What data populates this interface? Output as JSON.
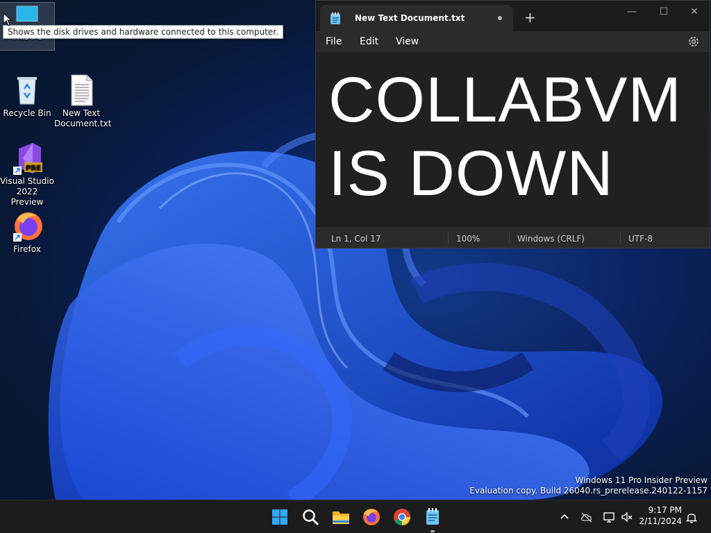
{
  "desktop": {
    "icons": [
      {
        "label": "This PC"
      },
      {
        "label": "Recycle Bin"
      },
      {
        "label": "New Text Document.txt",
        "line1": "New Text",
        "line2": "Document.txt"
      },
      {
        "label": "Visual Studio 2022 Preview",
        "line1": "Visual Studio",
        "line2": "2022 Preview",
        "badge": "PRE"
      },
      {
        "label": "Firefox"
      }
    ],
    "tooltip": "Shows the disk drives and hardware connected to this computer.",
    "watermark": {
      "line1": "Windows 11 Pro Insider Preview",
      "line2": "Evaluation copy. Build 26040.rs_prerelease.240122-1157"
    }
  },
  "notepad": {
    "tab_title": "New Text Document.txt",
    "new_tab": "+",
    "menu": [
      "File",
      "Edit",
      "View"
    ],
    "content": "COLLABVM\nIS DOWN",
    "status": {
      "position": "Ln 1, Col 17",
      "zoom": "100%",
      "line_endings": "Windows (CRLF)",
      "encoding": "UTF-8"
    },
    "window_controls": {
      "minimize": "—",
      "maximize": "☐",
      "close": "✕"
    }
  },
  "taskbar": {
    "apps": [
      {
        "name": "Start",
        "icon": "windows-logo-icon"
      },
      {
        "name": "Search",
        "icon": "search-icon"
      },
      {
        "name": "File Explorer",
        "icon": "folder-icon"
      },
      {
        "name": "Firefox",
        "icon": "firefox-icon"
      },
      {
        "name": "Chrome",
        "icon": "chrome-icon"
      },
      {
        "name": "Notepad",
        "icon": "notepad-icon",
        "active": true
      }
    ],
    "tray": [
      "chevron-up-icon",
      "cloud-offline-icon",
      "network-icon",
      "speaker-muted-icon"
    ],
    "clock": {
      "time": "9:17 PM",
      "date": "2/11/2024"
    },
    "notification_icon": "bell-icon"
  },
  "colors": {
    "accent": "#0078d4",
    "notepad_bg": "#202020",
    "taskbar_bg": "#1c1c1c"
  }
}
